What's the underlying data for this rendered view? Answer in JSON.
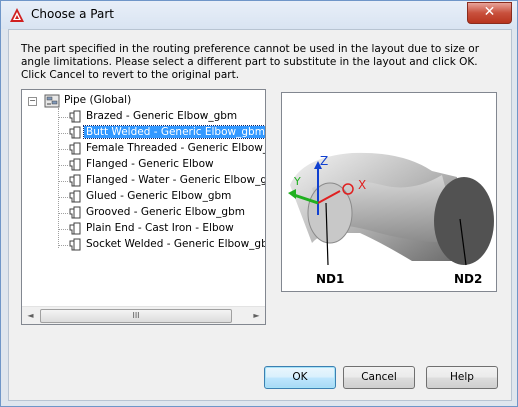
{
  "window": {
    "title": "Choose a Part",
    "close_glyph": "✕"
  },
  "message": "The part specified in the routing preference cannot be used in the layout due to size or angle limitations. Please select a different part to substitute in the layout and click OK. Click Cancel to revert to the original part.",
  "tree": {
    "root_label": "Pipe (Global)",
    "expander_glyph": "−",
    "items": [
      {
        "label": "Brazed - Generic Elbow_gbm",
        "selected": false
      },
      {
        "label": "Butt Welded - Generic Elbow_gbm",
        "selected": true
      },
      {
        "label": "Female Threaded - Generic Elbow_gb",
        "selected": false
      },
      {
        "label": "Flanged - Generic Elbow",
        "selected": false
      },
      {
        "label": "Flanged - Water - Generic Elbow_gbr",
        "selected": false
      },
      {
        "label": "Glued - Generic Elbow_gbm",
        "selected": false
      },
      {
        "label": "Grooved - Generic Elbow_gbm",
        "selected": false
      },
      {
        "label": "Plain End - Cast Iron - Elbow",
        "selected": false
      },
      {
        "label": "Socket Welded - Generic Elbow_gbm",
        "selected": false
      }
    ],
    "scroll_left_glyph": "◄",
    "scroll_right_glyph": "►",
    "scroll_thumb_grip": "III"
  },
  "preview": {
    "nd1_label": "ND1",
    "nd2_label": "ND2",
    "axis_x": "X",
    "axis_y": "Y",
    "axis_z": "Z"
  },
  "buttons": {
    "ok": "OK",
    "cancel": "Cancel",
    "help": "Help"
  }
}
